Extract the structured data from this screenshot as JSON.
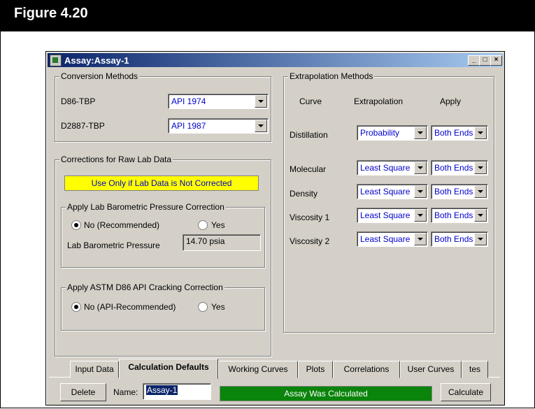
{
  "figure": {
    "title": "Figure 4.20"
  },
  "window": {
    "title": "Assay:Assay-1",
    "minimize": "_",
    "maximize": "□",
    "close": "×"
  },
  "conversion": {
    "legend": "Conversion Methods",
    "rows": [
      {
        "label": "D86-TBP",
        "value": "API 1974"
      },
      {
        "label": "D2887-TBP",
        "value": "API 1987"
      }
    ]
  },
  "corrections": {
    "legend": "Corrections for Raw Lab Data",
    "banner": "Use Only if Lab Data is Not Corrected",
    "barometric": {
      "legend": "Apply Lab Barometric Pressure Correction",
      "opt_no": "No (Recommended)",
      "opt_yes": "Yes",
      "selected": "no",
      "pressure_label": "Lab Barometric Pressure",
      "pressure_value": "14.70 psia"
    },
    "cracking": {
      "legend": "Apply ASTM D86 API Cracking Correction",
      "opt_no": "No (API-Recommended)",
      "opt_yes": "Yes",
      "selected": "no"
    }
  },
  "extrapolation": {
    "legend": "Extrapolation Methods",
    "headers": {
      "curve": "Curve",
      "extrapolation": "Extrapolation",
      "apply": "Apply"
    },
    "rows": [
      {
        "curve": "Distillation",
        "method": "Probability",
        "apply": "Both Ends"
      },
      {
        "curve": "Molecular",
        "method": "Least Square",
        "apply": "Both Ends"
      },
      {
        "curve": "Density",
        "method": "Least Square",
        "apply": "Both Ends"
      },
      {
        "curve": "Viscosity 1",
        "method": "Least Square",
        "apply": "Both Ends"
      },
      {
        "curve": "Viscosity 2",
        "method": "Least Square",
        "apply": "Both Ends"
      }
    ]
  },
  "tabs": [
    "Input Data",
    "Calculation Defaults",
    "Working Curves",
    "Plots",
    "Correlations",
    "User Curves",
    "tes"
  ],
  "active_tab": "Calculation Defaults",
  "footer": {
    "delete": "Delete",
    "name_label": "Name:",
    "name_value": "Assay-1",
    "status": "Assay Was Calculated",
    "calculate": "Calculate"
  },
  "colors": {
    "status_bg": "#008000",
    "banner_bg": "#ffff00",
    "titlebar": "#0a246a",
    "value_text": "#0000cc"
  }
}
